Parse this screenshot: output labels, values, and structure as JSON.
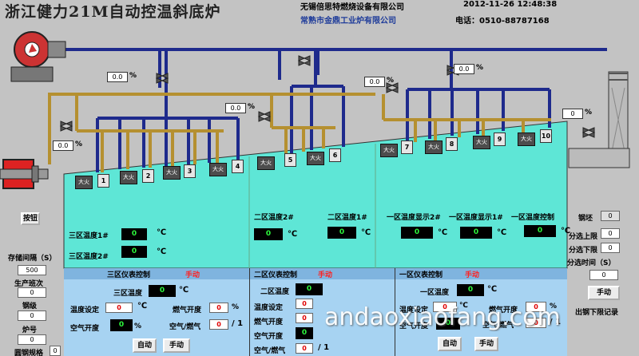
{
  "header": {
    "title": "浙江健力21M自动控温斜底炉",
    "company1": "无锡倍思特燃烧设备有限公司",
    "company2": "常熟市金鼎工业炉有限公司",
    "datetime": "2012-11-26 12:48:38",
    "phone": "电话：0510-88787168"
  },
  "valves": [
    {
      "value": "0.0",
      "unit": "%"
    },
    {
      "value": "0.0",
      "unit": "%"
    },
    {
      "value": "0.0",
      "unit": "%"
    },
    {
      "value": "0.0",
      "unit": "%"
    },
    {
      "value": "0.0",
      "unit": "%"
    },
    {
      "value": "0",
      "unit": "%"
    }
  ],
  "burners": {
    "fire_label": "大火",
    "numbers": [
      "1",
      "2",
      "3",
      "4",
      "5",
      "6",
      "7",
      "8",
      "9",
      "10"
    ]
  },
  "left": {
    "button": "按钮",
    "interval_label": "存储间隔（S）",
    "interval_value": "500",
    "shift_label": "生产班次",
    "shift_value": "0",
    "steel_label": "钢级",
    "steel_value": "0",
    "furnace_label": "炉号",
    "furnace_value": "0",
    "spec_label": "圆钢规格",
    "spec_value": "0"
  },
  "right": {
    "billet_label": "钢坯",
    "billet_value": "0",
    "upper_label": "分选上限",
    "upper_value": "0",
    "lower_label": "分选下限",
    "lower_value": "0",
    "time_label": "分选时间（S）",
    "time_value": "0",
    "manual_btn": "手动",
    "record_label": "出钢下限记录"
  },
  "zone3": {
    "t1_label": "三区温度1#",
    "t1_value": "0",
    "t2_label": "三区温度2#",
    "t2_value": "0",
    "unit": "℃"
  },
  "zone2": {
    "t1_label": "二区温度2#",
    "t1_value": "0",
    "t2_label": "二区温度1#",
    "t2_value": "0",
    "unit": "℃"
  },
  "zone1": {
    "t1_label": "一区温度显示2#",
    "t1_value": "0",
    "t2_label": "一区温度显示1#",
    "t2_value": "0",
    "t3_label": "一区温度控制",
    "t3_value": "0",
    "unit": "℃"
  },
  "panel3": {
    "title": "三区仪表控制",
    "mode": "手动",
    "temp_label": "三区温度",
    "temp_value": "0",
    "set_label": "温度设定",
    "set_value": "0",
    "gas_label": "燃气开度",
    "gas_value": "0",
    "air_label": "空气开度",
    "air_value": "0",
    "ratio_label": "空气/燃气",
    "ratio_value": "0",
    "ratio_sep": "/ 1",
    "auto_btn": "自动",
    "manual_btn": "手动",
    "c": "℃",
    "pct": "%"
  },
  "panel2": {
    "title": "二区仪表控制",
    "mode": "手动",
    "temp_label": "二区温度",
    "temp_value": "0",
    "set_label": "温度设定",
    "set_value": "0",
    "gas_label": "燃气开度",
    "gas_value": "0",
    "air_label": "空气开度",
    "air_value": "0",
    "ratio_label": "空气/燃气",
    "ratio_value": "0",
    "ratio_sep": "/ 1"
  },
  "panel1": {
    "title": "一区仪表控制",
    "mode": "手动",
    "temp_label": "一区温度",
    "temp_value": "0",
    "set_label": "温度设定",
    "set_value": "0",
    "gas_label": "燃气开度",
    "gas_value": "0",
    "air_label": "空气开度",
    "air_value": "0",
    "ratio_label": "空气/燃气",
    "ratio_value": "0",
    "ratio_sep": "/ 1",
    "auto_btn": "自动",
    "manual_btn": "手动",
    "c": "℃",
    "pct": "%"
  },
  "watermark": "andaoxiaofang.com",
  "colors": {
    "bg": "#c3c3c3",
    "furnace": "#5ee6d6",
    "panel": "#a7d3f2",
    "air_pipe": "#1e2a8c",
    "gas_pipe": "#b59030",
    "display_text": "#2df53c",
    "mode_text": "#ff2020"
  }
}
